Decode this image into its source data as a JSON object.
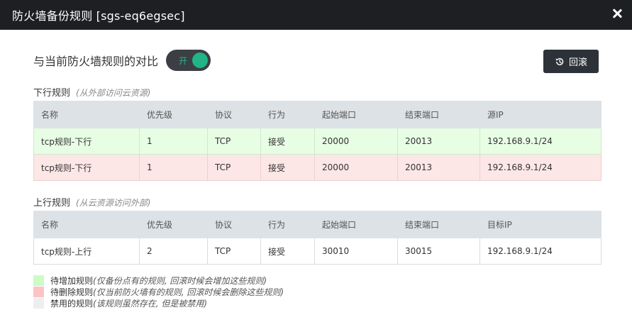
{
  "dialog": {
    "title": "防火墙备份规则 [sgs-eq6egsec]",
    "close_icon": "close-icon"
  },
  "compare": {
    "label": "与当前防火墙规则的对比",
    "toggle_text": "开",
    "toggle_on": true,
    "toggle_color": "#21b487"
  },
  "rollback": {
    "label": "回滚",
    "icon": "history-icon"
  },
  "downlink": {
    "title": "下行规则",
    "hint": "(从外部访问云资源)",
    "headers": [
      "名称",
      "优先级",
      "协议",
      "行为",
      "起始端口",
      "结束端口",
      "源IP"
    ],
    "rows": [
      {
        "status": "add",
        "cells": [
          "tcp规则-下行",
          "1",
          "TCP",
          "接受",
          "20000",
          "20013",
          "192.168.9.1/24"
        ]
      },
      {
        "status": "del",
        "cells": [
          "tcp规则-下行",
          "1",
          "TCP",
          "接受",
          "20000",
          "20013",
          "192.168.9.1/24"
        ]
      }
    ]
  },
  "uplink": {
    "title": "上行规则",
    "hint": "(从云资源访问外部)",
    "headers": [
      "名称",
      "优先级",
      "协议",
      "行为",
      "起始端口",
      "结束端口",
      "目标IP"
    ],
    "rows": [
      {
        "status": "normal",
        "cells": [
          "tcp规则-上行",
          "2",
          "TCP",
          "接受",
          "30010",
          "30015",
          "192.168.9.1/24"
        ]
      }
    ]
  },
  "legend": [
    {
      "label": "待增加规则",
      "note": "(仅备份点有的规则, 回滚时候会增加这些规则)",
      "color": "#ccfbc5"
    },
    {
      "label": "待删除规则",
      "note": "(仅当前防火墙有的规则, 回滚时候会删除这些规则)",
      "color": "#fcc4c4"
    },
    {
      "label": "禁用的规则",
      "note": "(该规则虽然存在, 但是被禁用)",
      "color": "#eeeeee"
    }
  ]
}
